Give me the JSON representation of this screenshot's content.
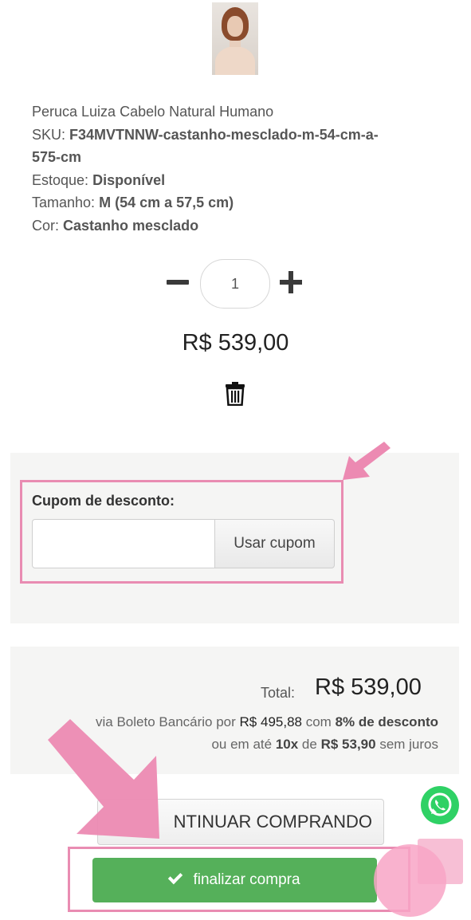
{
  "product": {
    "image_icon": "wig-on-mannequin-image",
    "name": "Peruca Luiza Cabelo Natural Humano",
    "sku_label": "SKU:",
    "sku_value_line1": "F34MVTNNW-castanho-mesclado-m-54-cm-a-",
    "sku_value_line2": "575-cm",
    "stock_label": "Estoque:",
    "stock_value": "Disponível",
    "size_label": "Tamanho:",
    "size_value": "M (54 cm a 57,5 cm)",
    "color_label": "Cor:",
    "color_value": "Castanho mesclado"
  },
  "quantity": {
    "value": "1"
  },
  "item_price": "R$ 539,00",
  "coupon": {
    "label": "Cupom de desconto:",
    "input_value": "",
    "button_label": "Usar cupom"
  },
  "totals": {
    "total_label": "Total:",
    "total_value": "R$ 539,00",
    "boleto_prefix": "via Boleto Bancário por",
    "boleto_price": "R$ 495,88",
    "boleto_with": "com",
    "boleto_discount": "8% de desconto",
    "installment_prefix": "ou em até",
    "installment_count": "10x",
    "installment_de": "de",
    "installment_value": "R$ 53,90",
    "installment_suffix": "sem juros"
  },
  "buttons": {
    "continue_label": "NTINUAR COMPRANDO",
    "checkout_label": "finalizar compra"
  },
  "colors": {
    "checkout_green": "#55b05a",
    "highlight_pink": "#e98cb2",
    "whatsapp_green": "#2fd165"
  }
}
